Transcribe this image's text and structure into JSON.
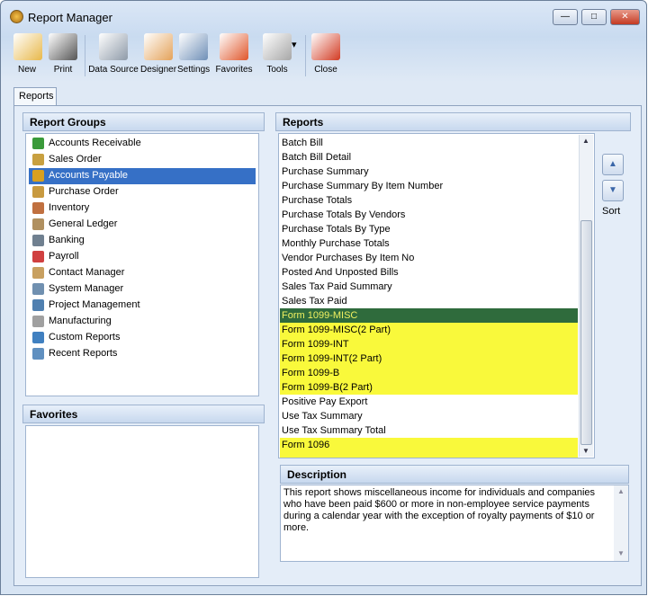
{
  "window": {
    "title": "Report Manager",
    "minimize": "—",
    "maximize": "□",
    "close": "✕"
  },
  "toolbar": [
    {
      "label": "New",
      "icon": "new-report-icon",
      "color": "#e8b84a"
    },
    {
      "label": "Print",
      "icon": "printer-icon",
      "color": "#555"
    },
    {
      "label": "Data Source",
      "icon": "database-icon",
      "color": "#8e9aa8"
    },
    {
      "label": "Designer",
      "icon": "designer-icon",
      "color": "#e4a25a"
    },
    {
      "label": "Settings",
      "icon": "settings-icon",
      "color": "#6f8fb7"
    },
    {
      "label": "Favorites",
      "icon": "favorites-icon",
      "color": "#e0562a"
    },
    {
      "label": "Tools",
      "icon": "tools-icon",
      "color": "#a7a7a7",
      "dropdown": "▾"
    },
    {
      "label": "Close",
      "icon": "close-report-icon",
      "color": "#d23a22"
    }
  ],
  "tabs": [
    {
      "label": "Reports"
    }
  ],
  "report_groups": {
    "title": "Report Groups",
    "selected": "Accounts Payable",
    "items": [
      {
        "label": "Accounts Receivable",
        "color": "#3a9a3a"
      },
      {
        "label": "Sales Order",
        "color": "#c8a040"
      },
      {
        "label": "Accounts Payable",
        "color": "#d8a020"
      },
      {
        "label": "Purchase Order",
        "color": "#c89a40"
      },
      {
        "label": "Inventory",
        "color": "#c07040"
      },
      {
        "label": "General Ledger",
        "color": "#b09060"
      },
      {
        "label": "Banking",
        "color": "#708090"
      },
      {
        "label": "Payroll",
        "color": "#d04040"
      },
      {
        "label": "Contact Manager",
        "color": "#c8a060"
      },
      {
        "label": "System Manager",
        "color": "#7090b0"
      },
      {
        "label": "Project Management",
        "color": "#5080b0"
      },
      {
        "label": "Manufacturing",
        "color": "#a0a0a0"
      },
      {
        "label": "Custom Reports",
        "color": "#4080c0"
      },
      {
        "label": "Recent Reports",
        "color": "#6090c0"
      }
    ]
  },
  "favorites": {
    "title": "Favorites"
  },
  "reports": {
    "title": "Reports",
    "selected": "Form 1099-MISC",
    "items": [
      {
        "label": "Batch Bill"
      },
      {
        "label": "Batch Bill Detail"
      },
      {
        "label": "Purchase Summary"
      },
      {
        "label": "Purchase Summary By Item Number"
      },
      {
        "label": "Purchase Totals"
      },
      {
        "label": "Purchase Totals By Vendors"
      },
      {
        "label": "Purchase Totals By Type"
      },
      {
        "label": "Monthly Purchase Totals"
      },
      {
        "label": "Vendor Purchases By Item No"
      },
      {
        "label": "Posted And Unposted Bills"
      },
      {
        "label": "Sales Tax Paid Summary"
      },
      {
        "label": "Sales Tax Paid"
      },
      {
        "label": "Form 1099-MISC",
        "highlight": true,
        "selected": true
      },
      {
        "label": "Form 1099-MISC(2 Part)",
        "highlight": true
      },
      {
        "label": "Form 1099-INT",
        "highlight": true
      },
      {
        "label": "Form 1099-INT(2 Part)",
        "highlight": true
      },
      {
        "label": "Form 1099-B",
        "highlight": true
      },
      {
        "label": "Form 1099-B(2 Part)",
        "highlight": true
      },
      {
        "label": "Positive Pay Export"
      },
      {
        "label": "Use Tax Summary"
      },
      {
        "label": "Use Tax Summary Total"
      },
      {
        "label": "Form 1096",
        "highlight": true
      }
    ]
  },
  "sort": {
    "label": "Sort",
    "up": "▲",
    "down": "▼"
  },
  "description": {
    "title": "Description",
    "text": "This report shows miscellaneous income for individuals and companies who have been paid $600 or more in non-employee service payments during a calendar year with the exception of royalty payments of $10 or more."
  },
  "colors": {
    "highlight": "#f9f93b",
    "selected_bg": "#2f6b3c",
    "group_selected": "#3670c6"
  }
}
